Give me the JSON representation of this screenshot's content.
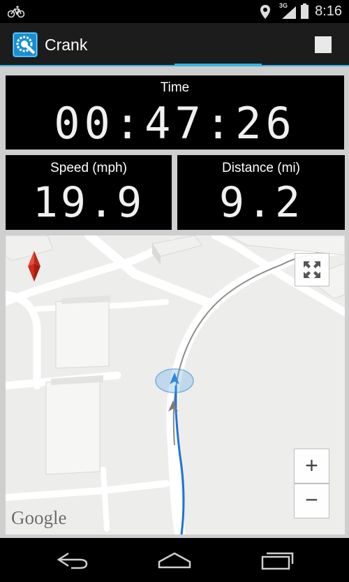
{
  "status_bar": {
    "time": "8:16",
    "network": "3G",
    "icons": [
      "bicycle-icon",
      "location-pin-icon",
      "signal-icon",
      "battery-icon"
    ]
  },
  "action_bar": {
    "title": "Crank",
    "app_icon": "crank-gear-icon",
    "stop_icon": "stop-icon"
  },
  "stats": {
    "time": {
      "label": "Time",
      "value": "00:47:26"
    },
    "speed": {
      "label": "Speed (mph)",
      "value": "19.9"
    },
    "distance": {
      "label": "Distance (mi)",
      "value": "9.2"
    }
  },
  "map": {
    "attribution": "Google",
    "zoom_in": "+",
    "zoom_out": "−",
    "controls": [
      "compass-icon",
      "fullscreen-icon",
      "zoom-in-button",
      "zoom-out-button"
    ]
  },
  "nav_bar": {
    "icons": [
      "back-icon",
      "home-icon",
      "recent-apps-icon"
    ]
  },
  "colors": {
    "accent": "#33b5e5",
    "route": "#1e73d8",
    "panel_bg": "#cfcfcf"
  }
}
